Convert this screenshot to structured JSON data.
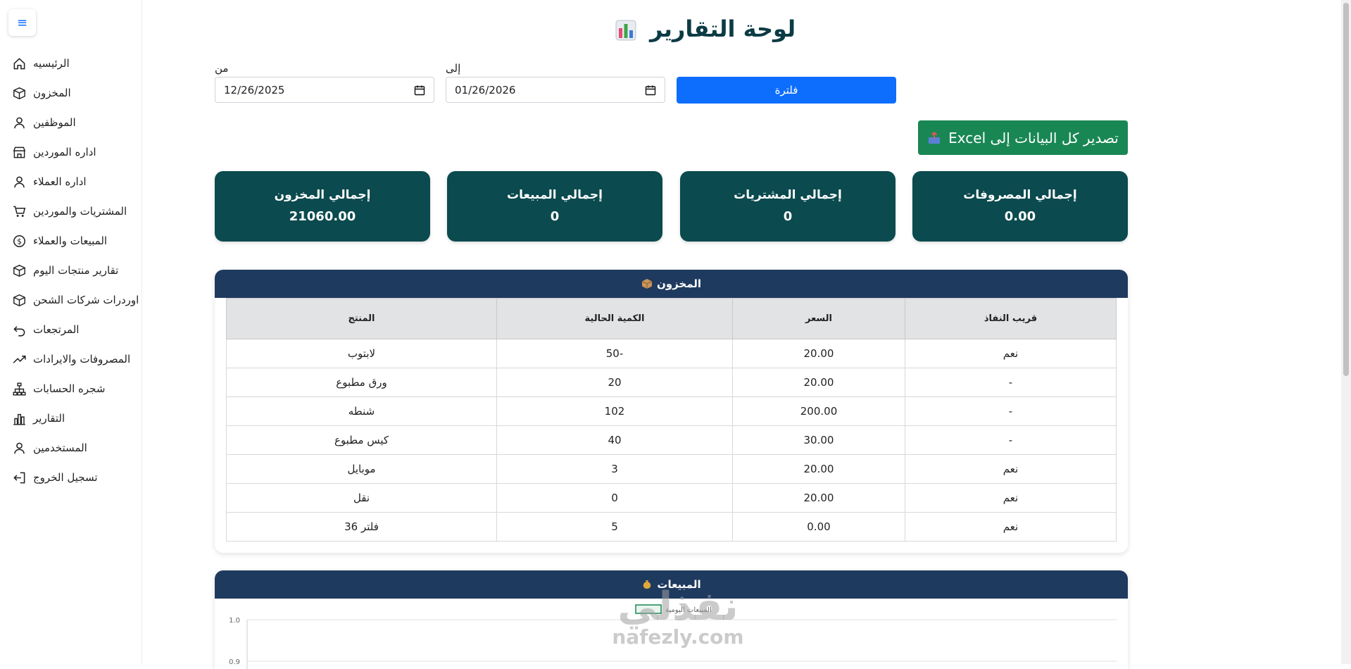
{
  "sidebar": {
    "menu_glyph": "≡",
    "items": [
      {
        "label": "الرئيسيه",
        "icon": "home-icon"
      },
      {
        "label": "المخزون",
        "icon": "box-icon"
      },
      {
        "label": "الموظفين",
        "icon": "person-icon"
      },
      {
        "label": "اداره الموردين",
        "icon": "shop-icon"
      },
      {
        "label": "اداره العملاء",
        "icon": "person-icon"
      },
      {
        "label": "المشتريات والموردين",
        "icon": "cart-icon"
      },
      {
        "label": "المبيعات والعملاء",
        "icon": "dollar-circle-icon"
      },
      {
        "label": "تقارير منتجات اليوم",
        "icon": "box-icon"
      },
      {
        "label": "اوردرات شركات الشحن",
        "icon": "box-icon"
      },
      {
        "label": "المرتجعات",
        "icon": "return-arrow-icon"
      },
      {
        "label": "المصروفات والايرادات",
        "icon": "trend-up-icon"
      },
      {
        "label": "شجره الحسابات",
        "icon": "hierarchy-icon"
      },
      {
        "label": "التقارير",
        "icon": "bar-chart-icon"
      },
      {
        "label": "المستخدمين",
        "icon": "person-icon"
      },
      {
        "label": "تسجيل الخروج",
        "icon": "logout-icon"
      }
    ]
  },
  "header": {
    "title": "لوحة التقارير"
  },
  "filter": {
    "from_label": "من",
    "from_value": "12/26/2025",
    "to_label": "إلى",
    "to_value": "01/26/2026",
    "button_label": "فلترة"
  },
  "export": {
    "label": "تصدير كل البيانات إلى Excel"
  },
  "cards": [
    {
      "title": "إجمالي المصروفات",
      "value": "0.00"
    },
    {
      "title": "إجمالي المشتريات",
      "value": "0"
    },
    {
      "title": "إجمالي المبيعات",
      "value": "0"
    },
    {
      "title": "إجمالي المخزون",
      "value": "21060.00"
    }
  ],
  "inventory": {
    "title": "المخزون",
    "columns": [
      "قريب النفاذ",
      "السعر",
      "الكمية الحالية",
      "المنتج"
    ],
    "rows": [
      [
        "نعم",
        "20.00",
        "-50",
        "لابتوب"
      ],
      [
        "-",
        "20.00",
        "20",
        "ورق مطبوع"
      ],
      [
        "-",
        "200.00",
        "102",
        "شنطه"
      ],
      [
        "-",
        "30.00",
        "40",
        "كيس مطبوع"
      ],
      [
        "نعم",
        "20.00",
        "3",
        "موبايل"
      ],
      [
        "نعم",
        "20.00",
        "0",
        "نقل"
      ],
      [
        "نعم",
        "0.00",
        "5",
        "فلتر 36"
      ]
    ]
  },
  "sales": {
    "title": "المبيعات",
    "legend_label": "المبيعات اليومية"
  },
  "chart_data": {
    "type": "line",
    "series": [
      {
        "name": "المبيعات اليومية",
        "values": []
      }
    ],
    "yticks": [
      "1.0",
      "0.9"
    ],
    "legend_color": "#198754"
  },
  "watermark": {
    "arabic": "نفذلي",
    "latin": "nafezly.com"
  }
}
